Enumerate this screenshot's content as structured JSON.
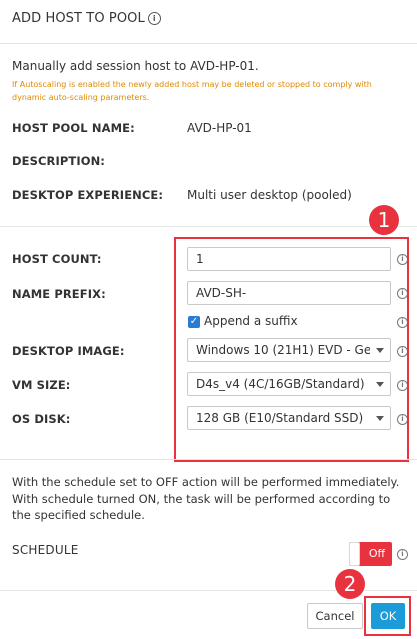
{
  "dialog": {
    "title": "ADD HOST TO POOL",
    "intro": "Manually add session host to AVD-HP-01.",
    "warning": "If Autoscaling is enabled the newly added host may be deleted or stopped to comply with dynamic auto-scaling parameters."
  },
  "info": [
    {
      "label": "HOST POOL NAME:",
      "value": "AVD-HP-01"
    },
    {
      "label": "DESCRIPTION:",
      "value": ""
    },
    {
      "label": "DESKTOP EXPERIENCE:",
      "value": "Multi user desktop (pooled)"
    }
  ],
  "form": {
    "host_count_label": "HOST COUNT:",
    "host_count_value": "1",
    "name_prefix_label": "NAME PREFIX:",
    "name_prefix_value": "AVD-SH-",
    "append_suffix_label": "Append a suffix",
    "append_suffix_checked": true,
    "desktop_image_label": "DESKTOP IMAGE:",
    "desktop_image_value": "Windows 10 (21H1) EVD - Ge...",
    "vm_size_label": "VM SIZE:",
    "vm_size_value": "D4s_v4 (4C/16GB/Standard)",
    "os_disk_label": "OS DISK:",
    "os_disk_value": "128 GB (E10/Standard SSD)"
  },
  "schedule": {
    "description": "With the schedule set to OFF action will be performed immediately. With schedule turned ON, the task will be performed according to the specified schedule.",
    "label": "SCHEDULE",
    "toggle_state": "Off"
  },
  "footer": {
    "cancel_label": "Cancel",
    "ok_label": "OK"
  },
  "annotations": {
    "badge_1": "1",
    "badge_2": "2"
  },
  "colors": {
    "accent": "#1b9bd7",
    "highlight": "#e8333f",
    "warning": "#e08a00"
  }
}
